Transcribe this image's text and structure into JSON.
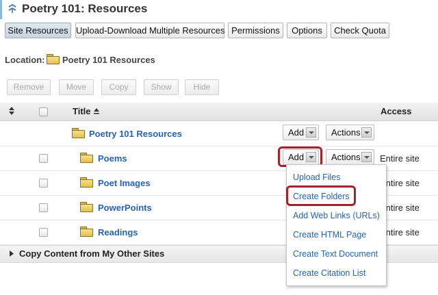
{
  "page": {
    "title": "Poetry 101: Resources"
  },
  "nav": [
    "Site Resources",
    "Upload-Download Multiple Resources",
    "Permissions",
    "Options",
    "Check Quota"
  ],
  "location": {
    "label": "Location:",
    "value": "Poetry 101 Resources"
  },
  "actions": [
    "Remove",
    "Move",
    "Copy",
    "Show",
    "Hide"
  ],
  "table": {
    "title_header": "Title",
    "access_header": "Access",
    "root": {
      "name": "Poetry 101 Resources",
      "add": "Add",
      "actions": "Actions"
    },
    "rows": [
      {
        "name": "Poems",
        "add": "Add",
        "actions": "Actions",
        "access": "Entire site"
      },
      {
        "name": "Poet Images",
        "access": "Entire site"
      },
      {
        "name": "PowerPoints",
        "access": "Entire site"
      },
      {
        "name": "Readings",
        "access": "Entire site"
      }
    ]
  },
  "add_menu": [
    "Upload Files",
    "Create Folders",
    "Add Web Links (URLs)",
    "Create HTML Page",
    "Create Text Document",
    "Create Citation List"
  ],
  "copy_section": "Copy Content from My Other Sites",
  "colors": {
    "link": "#2563b5",
    "highlight": "#a3222b"
  }
}
